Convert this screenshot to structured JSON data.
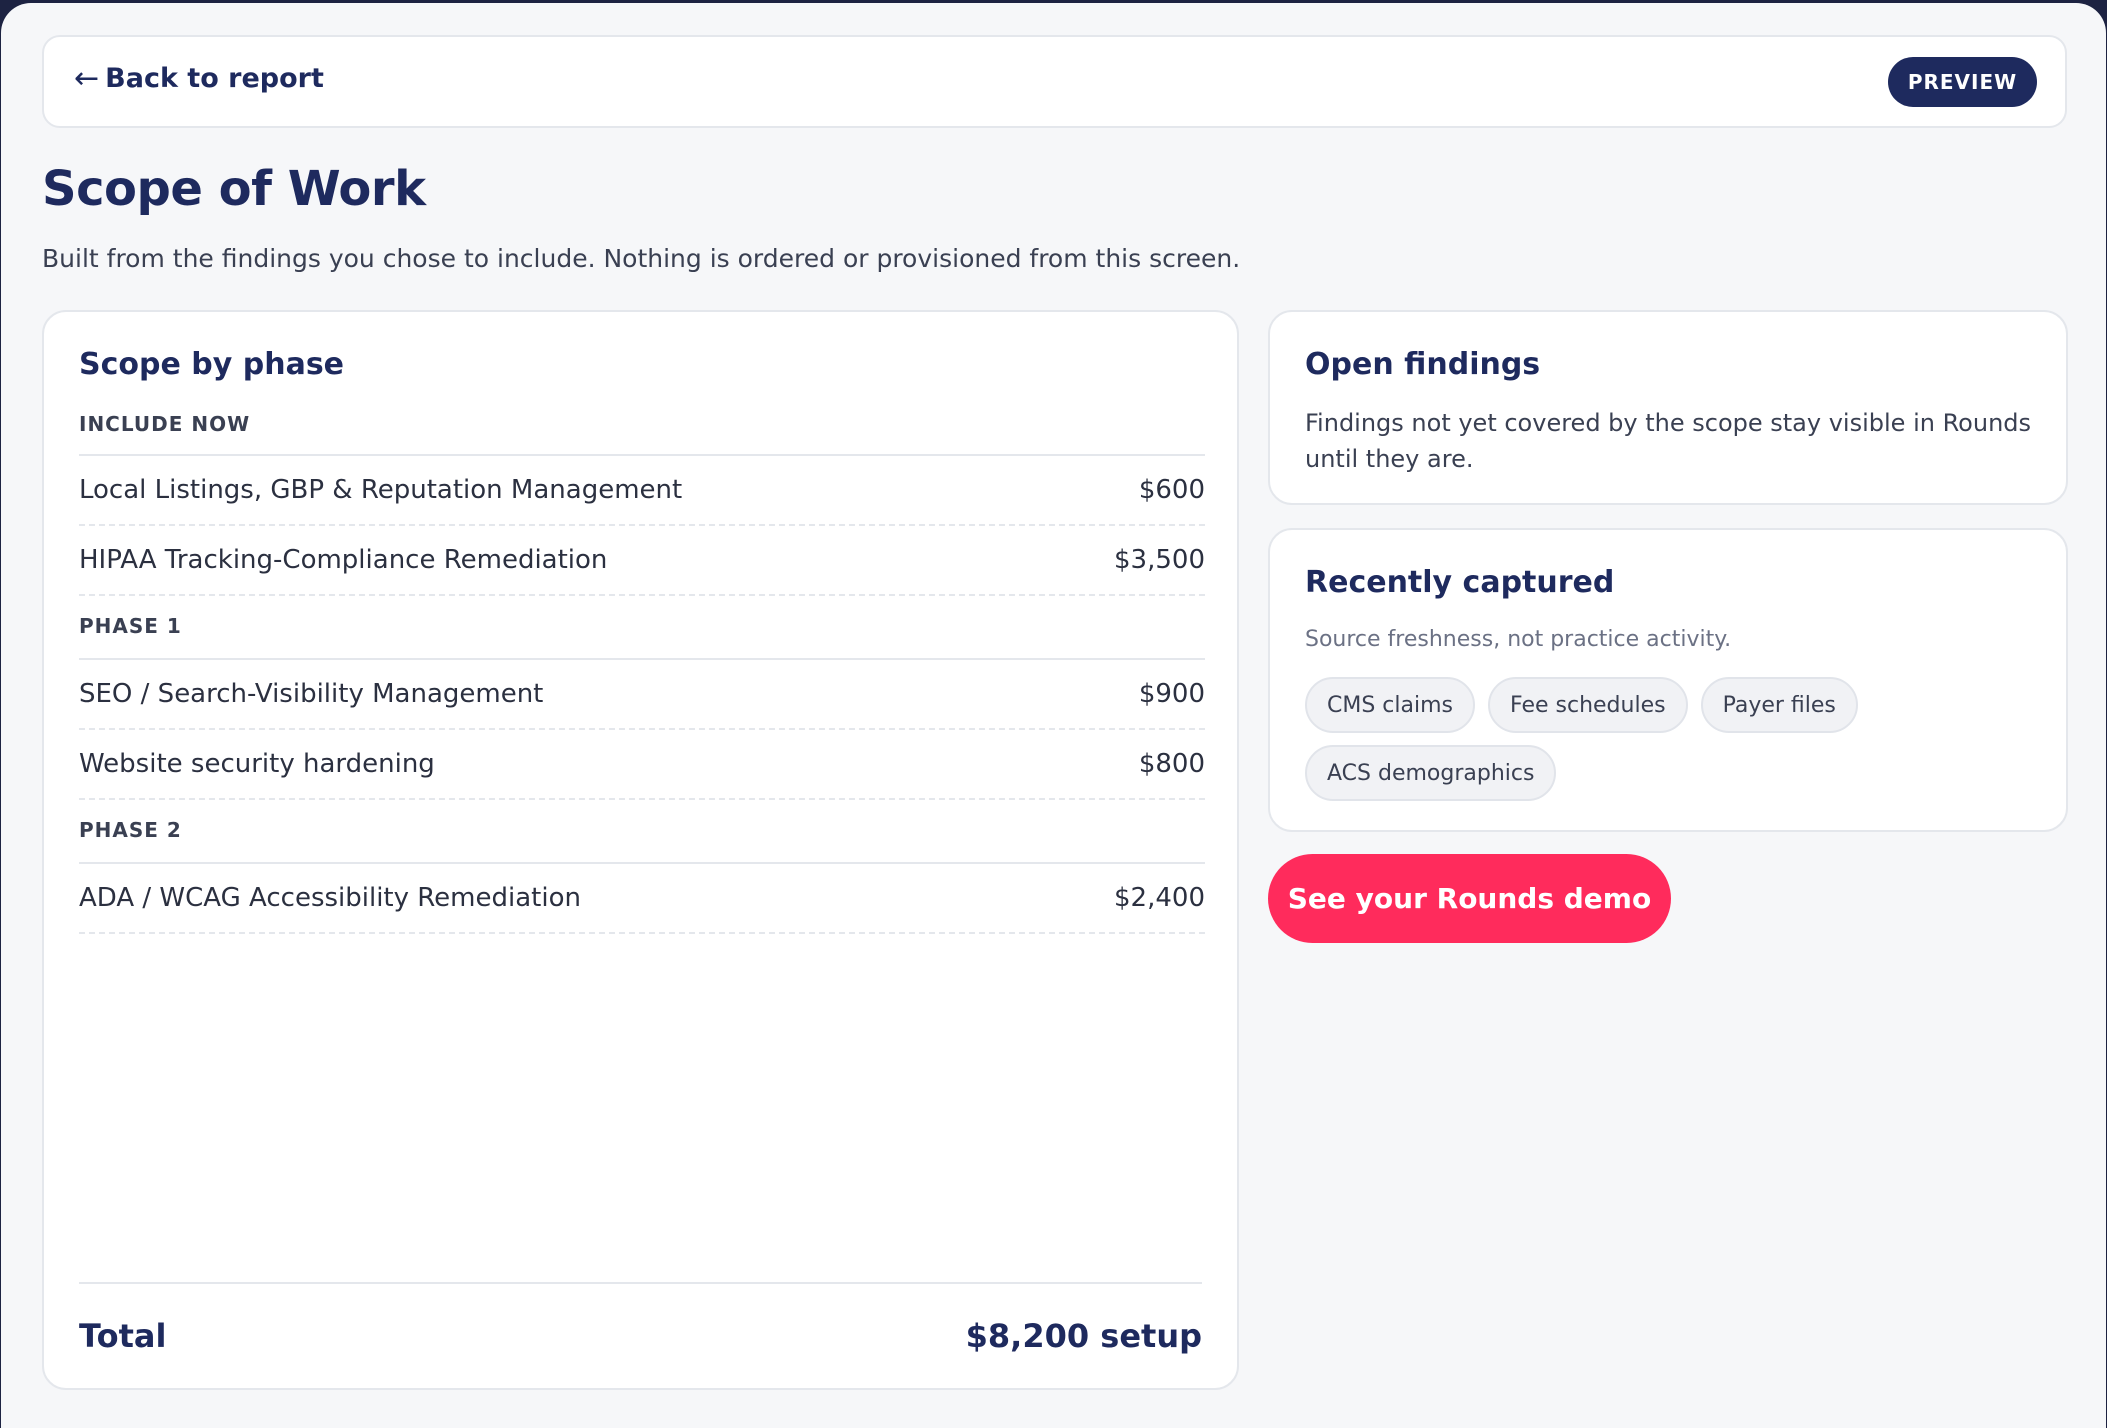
{
  "header": {
    "back_arrow": "←",
    "back_label": "Back to report",
    "badge": "PREVIEW"
  },
  "page": {
    "title": "Scope of Work",
    "subtitle": "Built from the findings you chose to include. Nothing is ordered or provisioned from this screen."
  },
  "scope": {
    "title": "Scope by phase",
    "phases": [
      {
        "label": "INCLUDE NOW",
        "items": [
          {
            "name": "Local Listings, GBP & Reputation Management",
            "price": "$600"
          },
          {
            "name": "HIPAA Tracking-Compliance Remediation",
            "price": "$3,500"
          }
        ]
      },
      {
        "label": "PHASE 1",
        "items": [
          {
            "name": "SEO / Search-Visibility Management",
            "price": "$900"
          },
          {
            "name": "Website security hardening",
            "price": "$800"
          }
        ]
      },
      {
        "label": "PHASE 2",
        "items": [
          {
            "name": "ADA / WCAG Accessibility Remediation",
            "price": "$2,400"
          }
        ]
      }
    ],
    "total_label": "Total",
    "total_value": "$8,200 setup"
  },
  "open_findings": {
    "title": "Open findings",
    "description": "Findings not yet covered by the scope stay visible in Rounds until they are."
  },
  "recently_captured": {
    "title": "Recently captured",
    "description": "Source freshness, not practice activity.",
    "chips": [
      "CMS claims",
      "Fee schedules",
      "Payer files",
      "ACS demographics"
    ]
  },
  "cta": {
    "label": "See your Rounds demo"
  },
  "colors": {
    "navy": "#1e2a5e",
    "accent": "#ff2b5c",
    "background": "#f6f7f9",
    "frame": "#1d2342"
  }
}
